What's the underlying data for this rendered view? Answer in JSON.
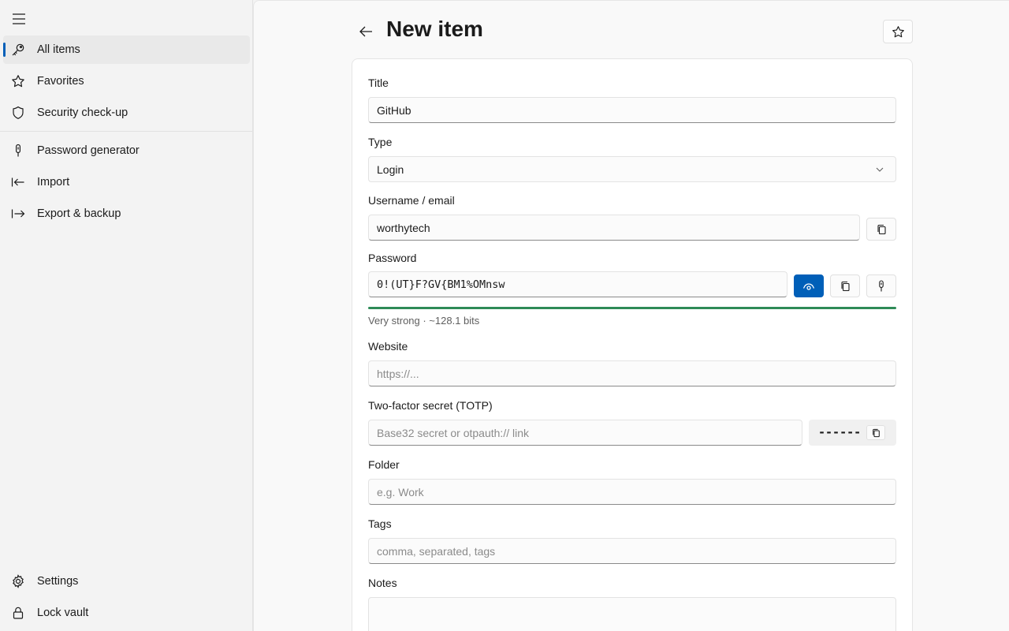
{
  "sidebar": {
    "items": [
      {
        "label": "All items",
        "icon": "key-icon"
      },
      {
        "label": "Favorites",
        "icon": "star-icon"
      },
      {
        "label": "Security check-up",
        "icon": "shield-icon"
      },
      {
        "label": "Password generator",
        "icon": "generator-icon"
      },
      {
        "label": "Import",
        "icon": "import-icon"
      },
      {
        "label": "Export & backup",
        "icon": "export-icon"
      }
    ],
    "bottom": [
      {
        "label": "Settings",
        "icon": "gear-icon"
      },
      {
        "label": "Lock vault",
        "icon": "lock-icon"
      }
    ]
  },
  "header": {
    "title": "New item"
  },
  "form": {
    "title": {
      "label": "Title",
      "value": "GitHub"
    },
    "type": {
      "label": "Type",
      "value": "Login"
    },
    "username": {
      "label": "Username / email",
      "value": "worthytech"
    },
    "password": {
      "label": "Password",
      "value": "0!(UT}F?GV{BM1%OMnsw",
      "strength_text": "Very strong · ~128.1 bits",
      "strength_fraction": 1.0
    },
    "website": {
      "label": "Website",
      "placeholder": "https://..."
    },
    "totp": {
      "label": "Two-factor secret (TOTP)",
      "placeholder": "Base32 secret or otpauth:// link",
      "code": "------"
    },
    "folder": {
      "label": "Folder",
      "placeholder": "e.g. Work"
    },
    "tags": {
      "label": "Tags",
      "placeholder": "comma, separated, tags"
    },
    "notes": {
      "label": "Notes"
    }
  },
  "colors": {
    "accent": "#005fb8",
    "strength": "#2e8b57"
  }
}
